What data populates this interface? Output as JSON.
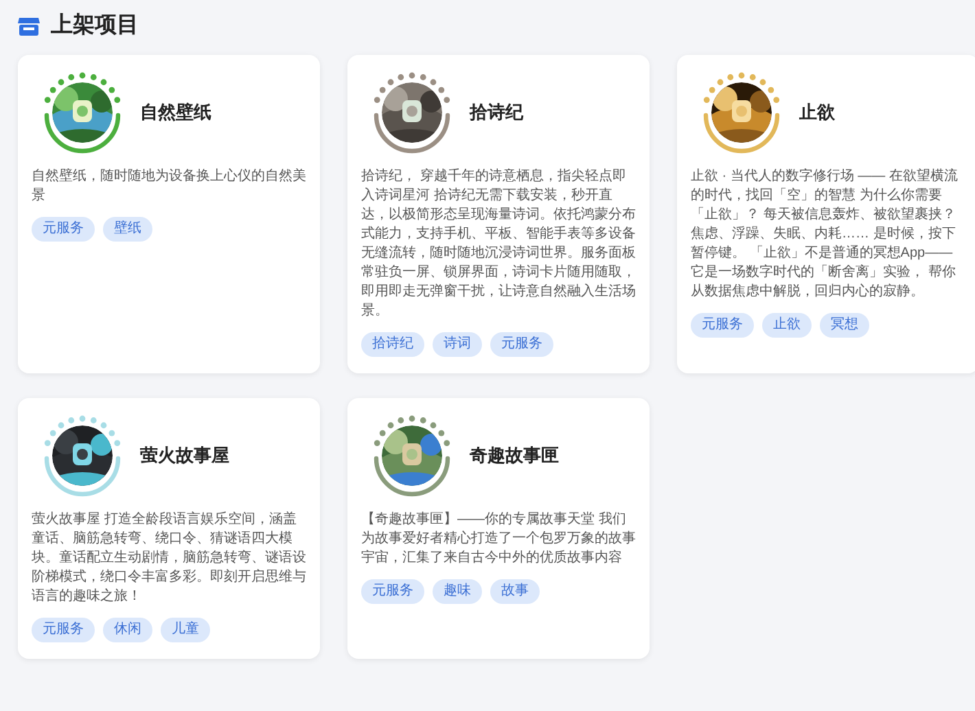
{
  "section": {
    "title": "上架项目"
  },
  "projects": [
    {
      "name": "自然壁纸",
      "color": "#4caf3e",
      "description": "自然壁纸，随时随地为设备换上心仪的自然美景",
      "tags": [
        "元服务",
        "壁纸"
      ]
    },
    {
      "name": "拾诗纪",
      "color": "#9b8f84",
      "description": "拾诗纪， 穿越千年的诗意栖息，指尖轻点即入诗词星河 拾诗纪无需下载安装，秒开直达，以极简形态呈现海量诗词。依托鸿蒙分布式能力，支持手机、平板、智能手表等多设备无缝流转，随时随地沉浸诗词世界。服务面板常驻负一屏、锁屏界面，诗词卡片随用随取，即用即走无弹窗干扰，让诗意自然融入生活场景。",
      "tags": [
        "拾诗纪",
        "诗词",
        "元服务"
      ]
    },
    {
      "name": "止欲",
      "color": "#e2b85a",
      "description": "止欲 · 当代人的数字修行场 —— 在欲望横流的时代，找回「空」的智慧 为什么你需要「止欲」？ 每天被信息轰炸、被欲望裹挟？焦虑、浮躁、失眠、内耗…… 是时候，按下暂停键。 「止欲」不是普通的冥想App——它是一场数字时代的「断舍离」实验， 帮你从数据焦虑中解脱，回归内心的寂静。",
      "tags": [
        "元服务",
        "止欲",
        "冥想"
      ]
    },
    {
      "name": "萤火故事屋",
      "color": "#a8dde6",
      "description": "萤火故事屋 打造全龄段语言娱乐空间，涵盖童话、脑筋急转弯、绕口令、猜谜语四大模块。童话配立生动剧情，脑筋急转弯、谜语设阶梯模式，绕口令丰富多彩。即刻开启思维与语言的趣味之旅！",
      "tags": [
        "元服务",
        "休闲",
        "儿童"
      ]
    },
    {
      "name": "奇趣故事匣",
      "color": "#8a9c7c",
      "description": "【奇趣故事匣】——你的专属故事天堂 我们为故事爱好者精心打造了一个包罗万象的故事宇宙，汇集了来自古今中外的优质故事内容",
      "tags": [
        "元服务",
        "趣味",
        "故事"
      ]
    }
  ]
}
